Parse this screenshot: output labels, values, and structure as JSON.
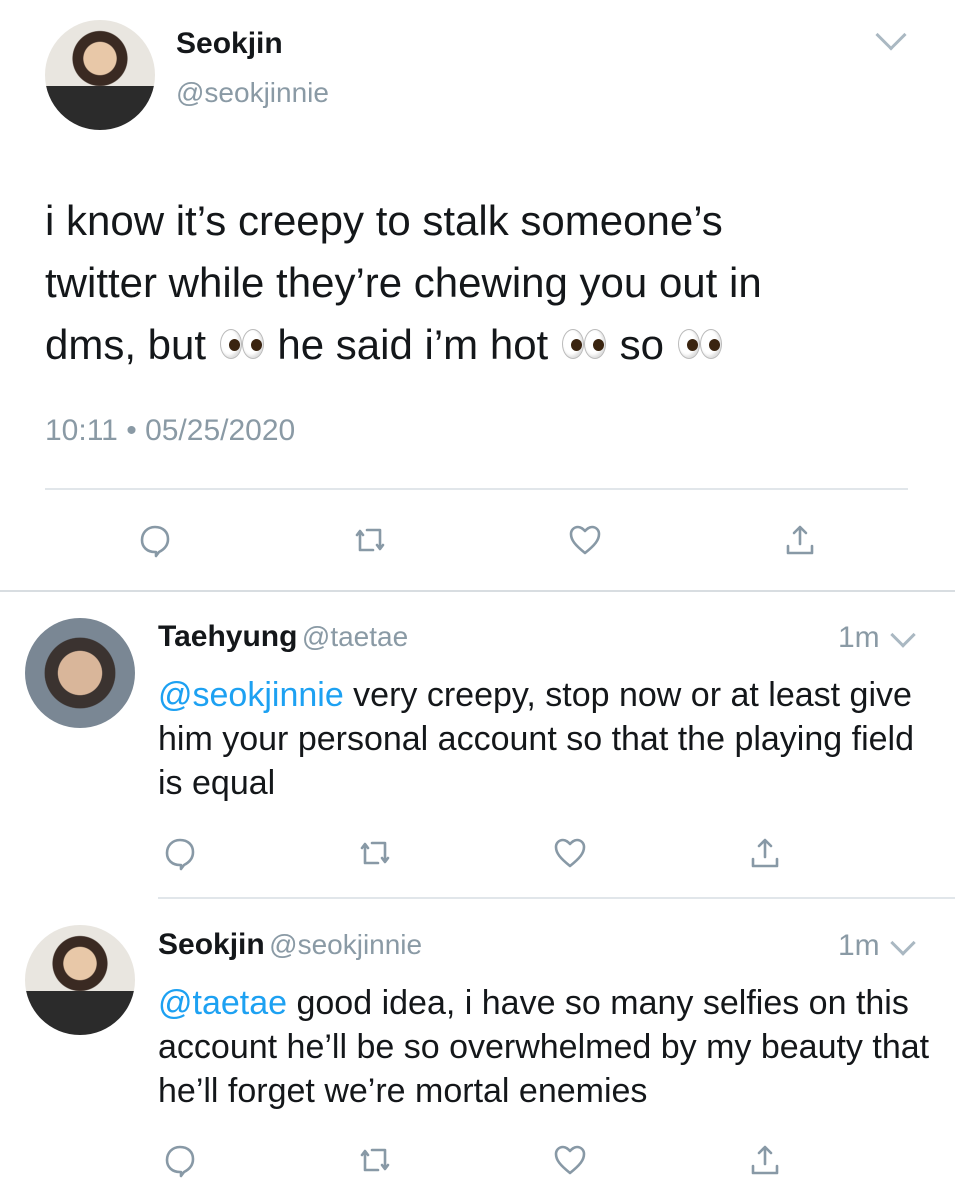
{
  "main_tweet": {
    "name": "Seokjin",
    "handle": "@seokjinnie",
    "text": [
      "i know it’s creepy to stalk someone’s",
      "twitter while they’re chewing you out in",
      "dms, but",
      " he said i’m hot",
      " so"
    ],
    "emoji": "eyes",
    "time": "10:11",
    "separator": "•",
    "date": "05/25/2020"
  },
  "replies": [
    {
      "name": "Taehyung",
      "handle": "@taetae",
      "time": "1m",
      "mention": "@seokjinnie",
      "text": " very creepy, stop now or at least give him your personal account so that the playing field is equal"
    },
    {
      "name": "Seokjin",
      "handle": "@seokjinnie",
      "time": "1m",
      "mention": "@taetae",
      "text": " good idea, i have so many selfies on this account he’ll be so overwhelmed by my beauty that he’ll forget we’re mortal enemies"
    }
  ],
  "icons": [
    "reply-icon",
    "retweet-icon",
    "like-icon",
    "share-icon",
    "chevron-down-icon"
  ],
  "colors": {
    "link": "#1da1f2",
    "icon": "#8899a6",
    "divider": "#d8dde1"
  }
}
